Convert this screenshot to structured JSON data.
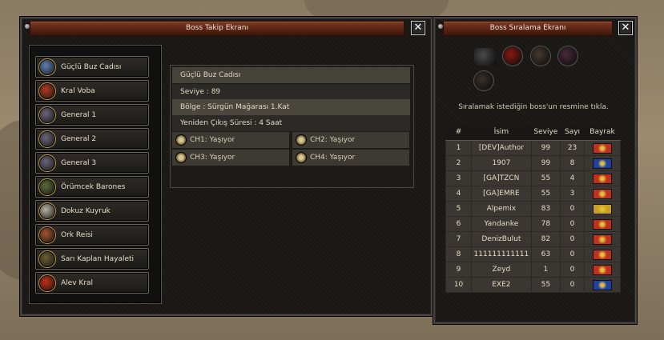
{
  "tracker": {
    "title": "Boss Takip Ekranı",
    "close": "✕",
    "bosses": [
      {
        "label": "Güçlü Buz Cadısı",
        "icon": "ice-witch-icon",
        "color": "#5f7fb0"
      },
      {
        "label": "Kral Voba",
        "icon": "king-voba-icon",
        "color": "#b03a22"
      },
      {
        "label": "General 1",
        "icon": "general-icon",
        "color": "#6b6478"
      },
      {
        "label": "General 2",
        "icon": "general-icon",
        "color": "#6b6478"
      },
      {
        "label": "General 3",
        "icon": "general-icon",
        "color": "#6b6478"
      },
      {
        "label": "Örümcek Barones",
        "icon": "spider-icon",
        "color": "#5a6a38"
      },
      {
        "label": "Dokuz Kuyruk",
        "icon": "nine-tails-icon",
        "color": "#b8b0a0"
      },
      {
        "label": "Ork Reisi",
        "icon": "orc-icon",
        "color": "#a0552c"
      },
      {
        "label": "Sarı Kaplan Hayaleti",
        "icon": "tiger-icon",
        "color": "#6a6032"
      },
      {
        "label": "Alev Kral",
        "icon": "flame-king-icon",
        "color": "#c03018"
      }
    ],
    "info": {
      "name": "Güçlü Buz Cadısı",
      "level": "Seviye : 89",
      "region": "Bölge : Sürgün Mağarası 1.Kat",
      "respawn": "Yeniden Çıkış Süresi : 4 Saat",
      "channels": [
        "CH1: Yaşıyor",
        "CH2: Yaşıyor",
        "CH3: Yaşıyor",
        "CH4: Yaşıyor"
      ]
    }
  },
  "ranking": {
    "title": "Boss Sıralama Ekranı",
    "close": "✕",
    "hint": "Sıralamak istediğin boss'un resmine tıkla.",
    "icons": [
      {
        "icon": "dragon-icon",
        "color": "#4a4a4a"
      },
      {
        "icon": "red-dragon-icon",
        "color": "#8a1a12"
      },
      {
        "icon": "boss-portrait-icon",
        "color": "#4a3a30"
      },
      {
        "icon": "boss-portrait-icon",
        "color": "#4a2a3a"
      },
      {
        "icon": "boss-portrait-icon",
        "color": "#3a3028"
      }
    ],
    "headers": [
      "#",
      "İsim",
      "Seviye",
      "Sayı",
      "Bayrak"
    ],
    "rows": [
      {
        "rank": "1",
        "name": "[DEV]Author",
        "level": "99",
        "count": "23",
        "flag": "#c0301c"
      },
      {
        "rank": "2",
        "name": "1907",
        "level": "99",
        "count": "8",
        "flag": "#2040a0"
      },
      {
        "rank": "3",
        "name": "[GA]TZCN",
        "level": "55",
        "count": "4",
        "flag": "#c0301c"
      },
      {
        "rank": "4",
        "name": "[GA]EMRE",
        "level": "55",
        "count": "3",
        "flag": "#c0301c"
      },
      {
        "rank": "5",
        "name": "Alpemix",
        "level": "83",
        "count": "0",
        "flag": "#c8a020"
      },
      {
        "rank": "6",
        "name": "Yandanke",
        "level": "78",
        "count": "0",
        "flag": "#c0301c"
      },
      {
        "rank": "7",
        "name": "DenizBulut",
        "level": "82",
        "count": "0",
        "flag": "#c0301c"
      },
      {
        "rank": "8",
        "name": "111111111111",
        "level": "63",
        "count": "0",
        "flag": "#c0301c"
      },
      {
        "rank": "9",
        "name": "Zeyd",
        "level": "1",
        "count": "0",
        "flag": "#c0301c"
      },
      {
        "rank": "10",
        "name": "EXE2",
        "level": "55",
        "count": "0",
        "flag": "#2040a0"
      }
    ]
  }
}
